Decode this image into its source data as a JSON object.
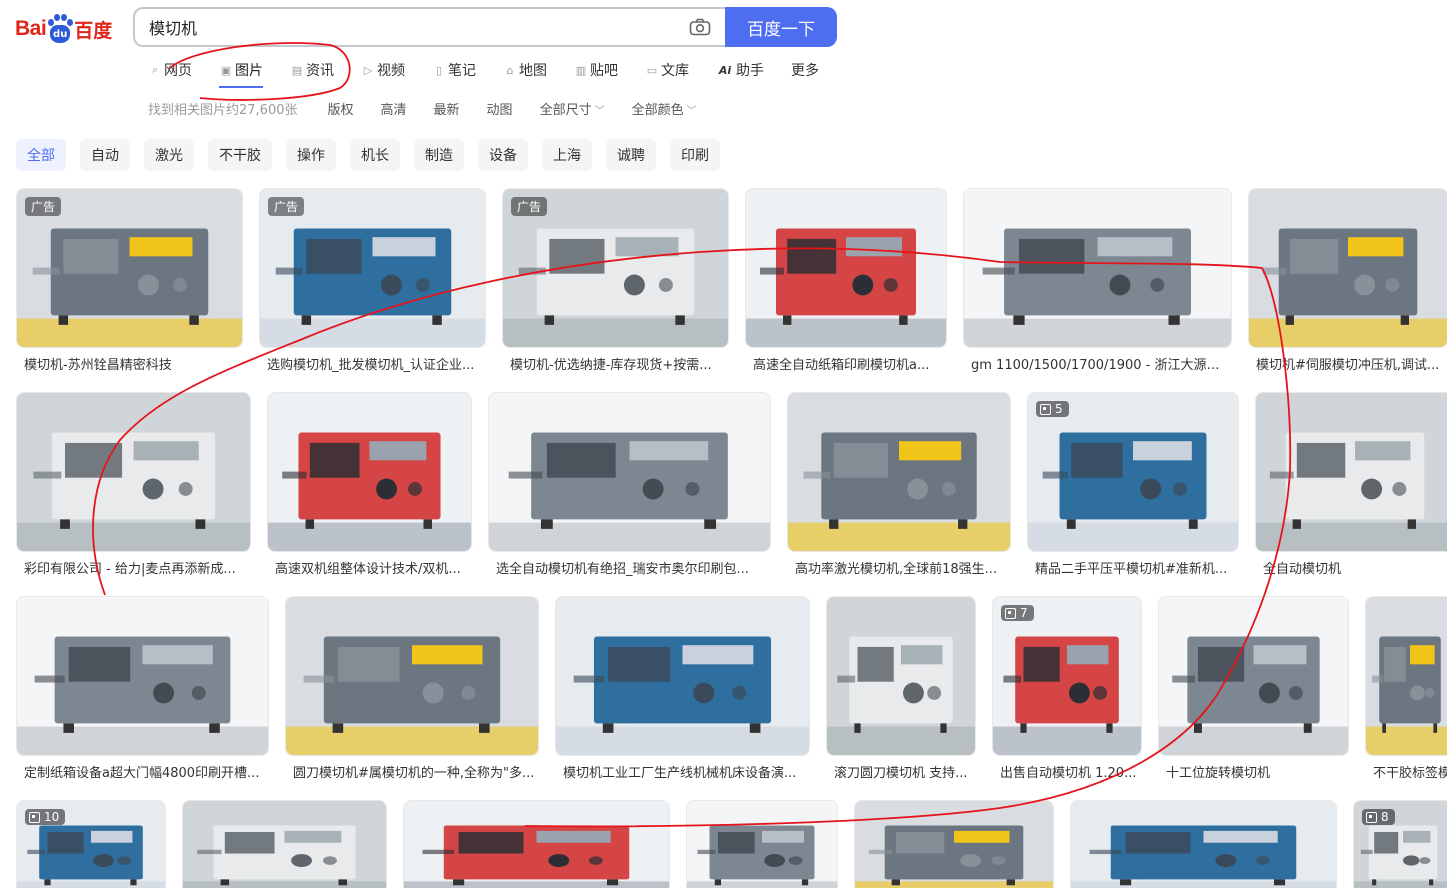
{
  "logo": {
    "text_bai": "Bai",
    "text_du": "du",
    "text_cn": "百度"
  },
  "search": {
    "query": "模切机",
    "button_label": "百度一下"
  },
  "tabs": [
    {
      "label": "网页",
      "icon": "search-icon"
    },
    {
      "label": "图片",
      "icon": "image-icon",
      "active": true
    },
    {
      "label": "资讯",
      "icon": "news-icon"
    },
    {
      "label": "视频",
      "icon": "video-icon"
    },
    {
      "label": "笔记",
      "icon": "note-icon"
    },
    {
      "label": "地图",
      "icon": "map-icon"
    },
    {
      "label": "贴吧",
      "icon": "tieba-icon"
    },
    {
      "label": "文库",
      "icon": "wenku-icon"
    },
    {
      "label": "助手",
      "icon": "ai-icon"
    },
    {
      "label": "更多",
      "icon": ""
    }
  ],
  "filters": {
    "count": "找到相关图片约27,600张",
    "items": [
      "版权",
      "高清",
      "最新",
      "动图",
      "全部尺寸",
      "全部颜色"
    ]
  },
  "chips": [
    "全部",
    "自动",
    "激光",
    "不干胶",
    "操作",
    "机长",
    "制造",
    "设备",
    "上海",
    "诚聘",
    "印刷"
  ],
  "rows": [
    [
      {
        "caption": "模切机-苏州铨昌精密科技",
        "badge": "广告"
      },
      {
        "caption": "选购模切机_批发模切机_认证企业...",
        "badge": "广告"
      },
      {
        "caption": "模切机-优选纳捷-库存现货+按需...",
        "badge": "广告"
      },
      {
        "caption": "高速全自动纸箱印刷模切机a..."
      },
      {
        "caption": "gm 1100/1500/1700/1900 - 浙江大源机械..."
      },
      {
        "caption": "模切机#伺服模切冲压机,调试..."
      }
    ],
    [
      {
        "caption": "彩印有限公司 - 给力|麦点再添新成..."
      },
      {
        "caption": "高速双机组整体设计技术/双机..."
      },
      {
        "caption": "选全自动模切机有绝招_瑞安市奥尔印刷包..."
      },
      {
        "caption": "高功率激光模切机,全球前18强生..."
      },
      {
        "caption": "精品二手平压平模切机#准新机...",
        "multi": "5"
      },
      {
        "caption": "全自动模切机"
      }
    ],
    [
      {
        "caption": "定制纸箱设备a超大门幅4800印刷开槽..."
      },
      {
        "caption": "圆刀模切机#属模切机的一种,全称为\"多..."
      },
      {
        "caption": "模切机工业工厂生产线机械机床设备演..."
      },
      {
        "caption": "滚刀圆刀模切机 支持..."
      },
      {
        "caption": "出售自动模切机 1.20...",
        "multi": "7"
      },
      {
        "caption": "十工位旋转模切机"
      },
      {
        "caption": "不干胶标签模"
      }
    ],
    [
      {
        "caption": "",
        "multi": "10"
      },
      {
        "caption": ""
      },
      {
        "caption": ""
      },
      {
        "caption": ""
      },
      {
        "caption": ""
      },
      {
        "caption": ""
      },
      {
        "caption": "",
        "multi": "8"
      }
    ]
  ],
  "colors": {
    "accent": "#4e6ef2",
    "brand_red": "#e1251b",
    "annotation": "#e5141b"
  }
}
